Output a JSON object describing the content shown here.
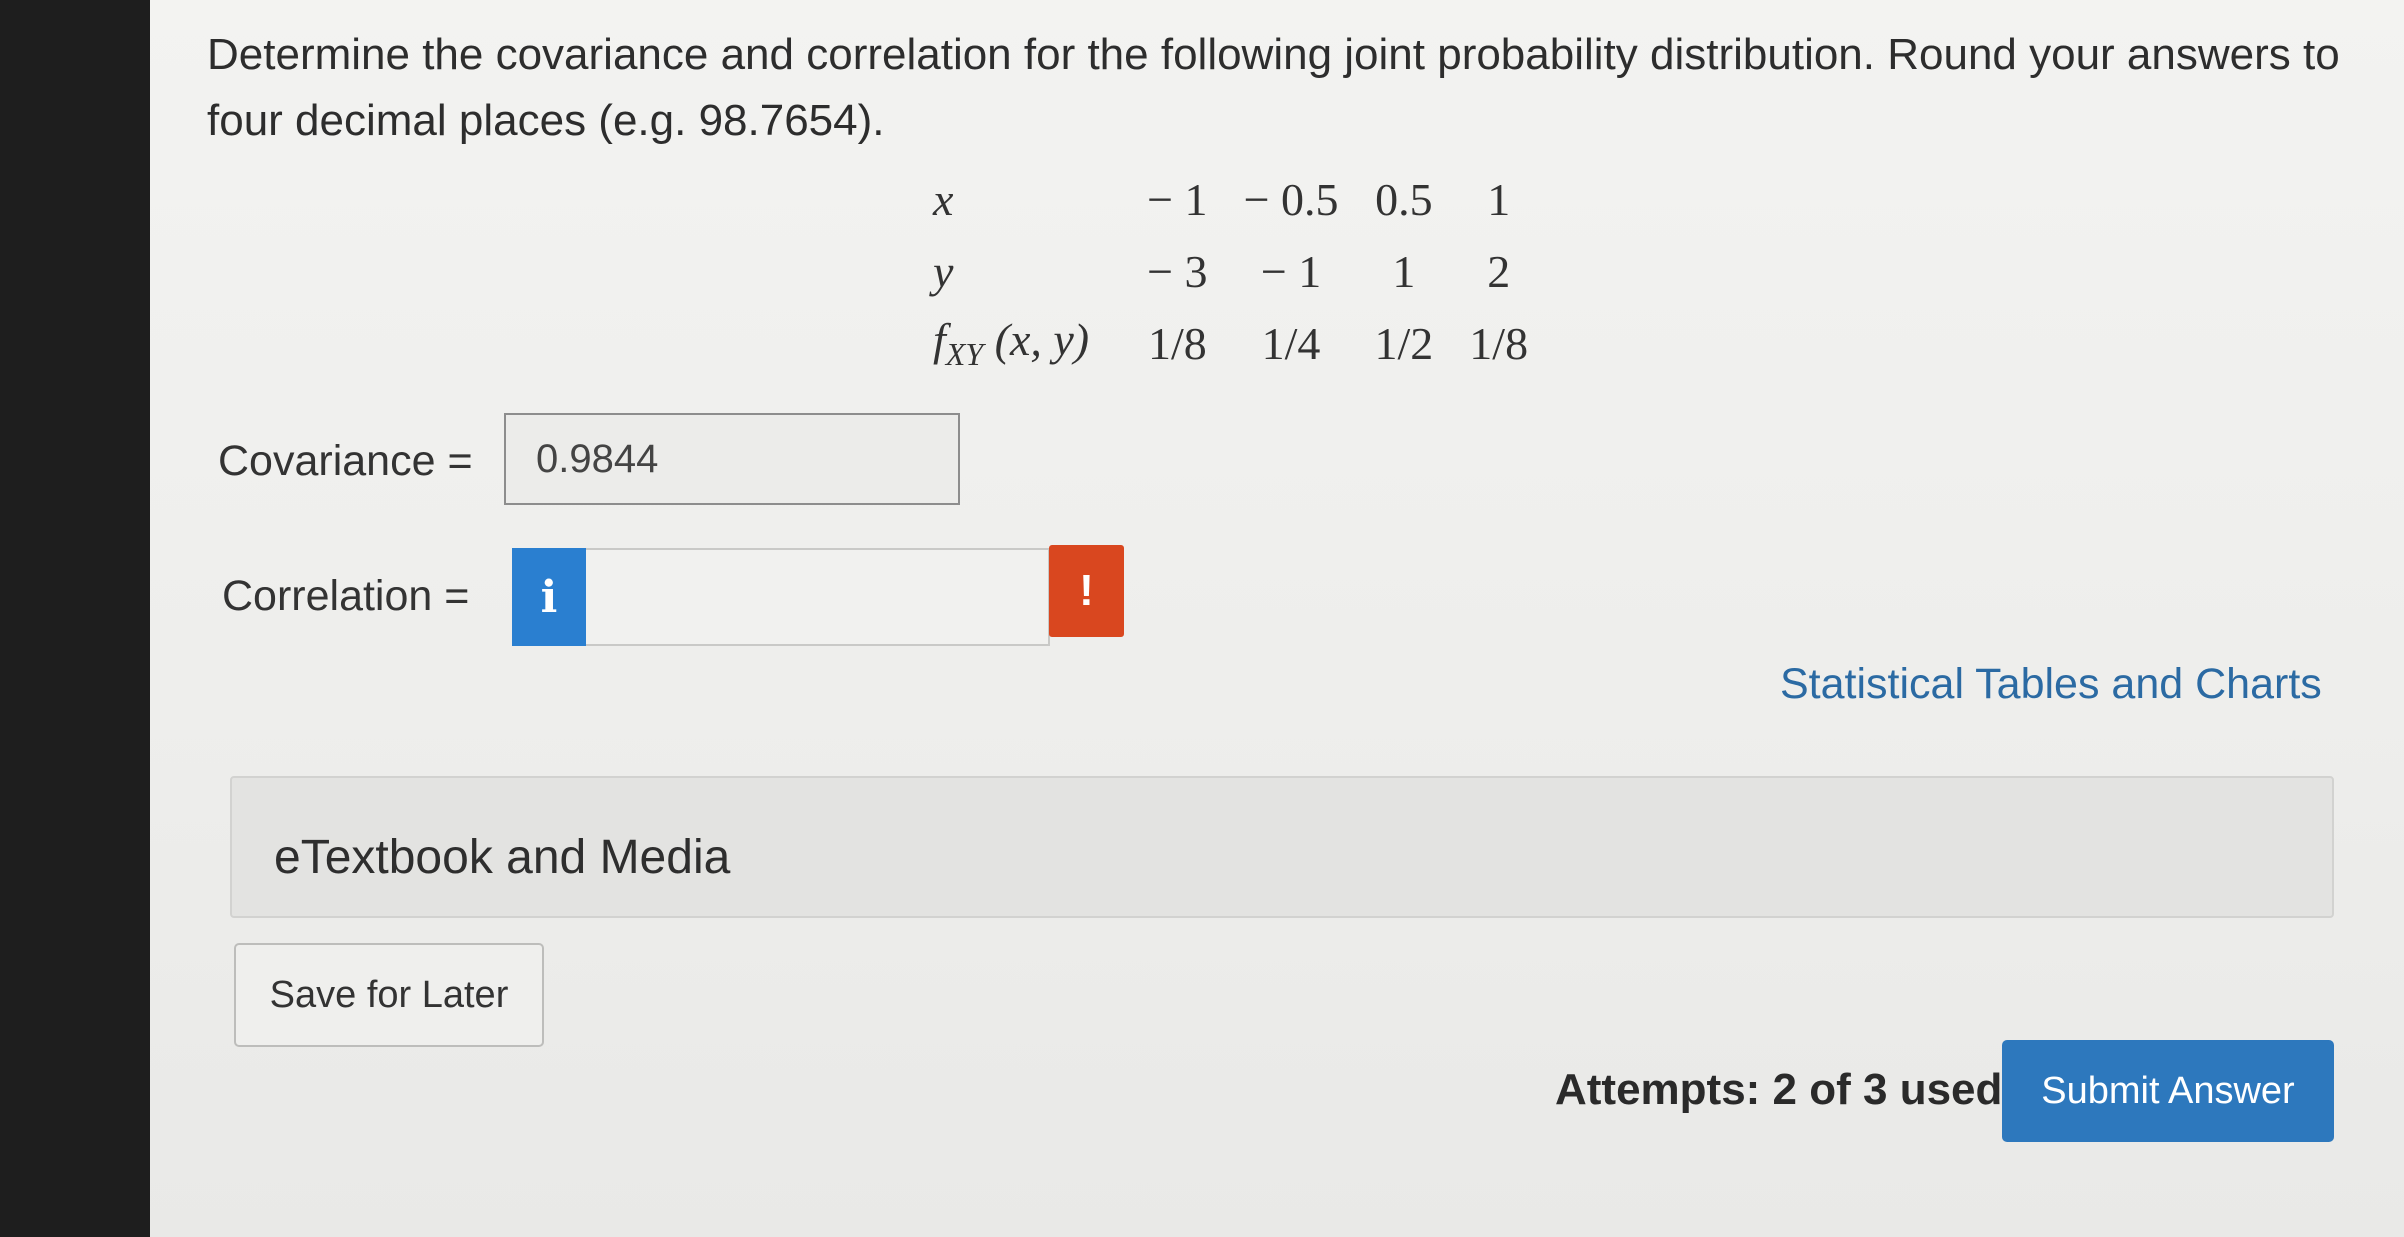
{
  "question": {
    "text": "Determine the covariance and correlation for the following joint probability distribution. Round your answers to four decimal places (e.g. 98.7654)."
  },
  "distribution": {
    "x_label": "x",
    "y_label": "y",
    "f_label_main": "f",
    "f_label_sub": "XY",
    "f_label_args": " (x, y)",
    "x_values": [
      "− 1",
      "− 0.5",
      "0.5",
      "1"
    ],
    "y_values": [
      "− 3",
      "− 1",
      "1",
      "2"
    ],
    "f_values": [
      "1/8",
      "1/4",
      "1/2",
      "1/8"
    ]
  },
  "covariance": {
    "label": "Covariance =",
    "value": "0.9844"
  },
  "correlation": {
    "label": "Correlation =",
    "value": "",
    "info_glyph": "i",
    "warning_glyph": "!"
  },
  "links": {
    "stat_tables": "Statistical Tables and Charts"
  },
  "media": {
    "label": "eTextbook and Media"
  },
  "buttons": {
    "save": "Save for Later",
    "submit": "Submit Answer"
  },
  "attempts": {
    "text": "Attempts: 2 of 3 used"
  },
  "colors": {
    "info_blue": "#2a7fd0",
    "warning_red": "#d9471f",
    "submit_blue": "#2d78bd",
    "link_blue": "#2b6aa3"
  }
}
